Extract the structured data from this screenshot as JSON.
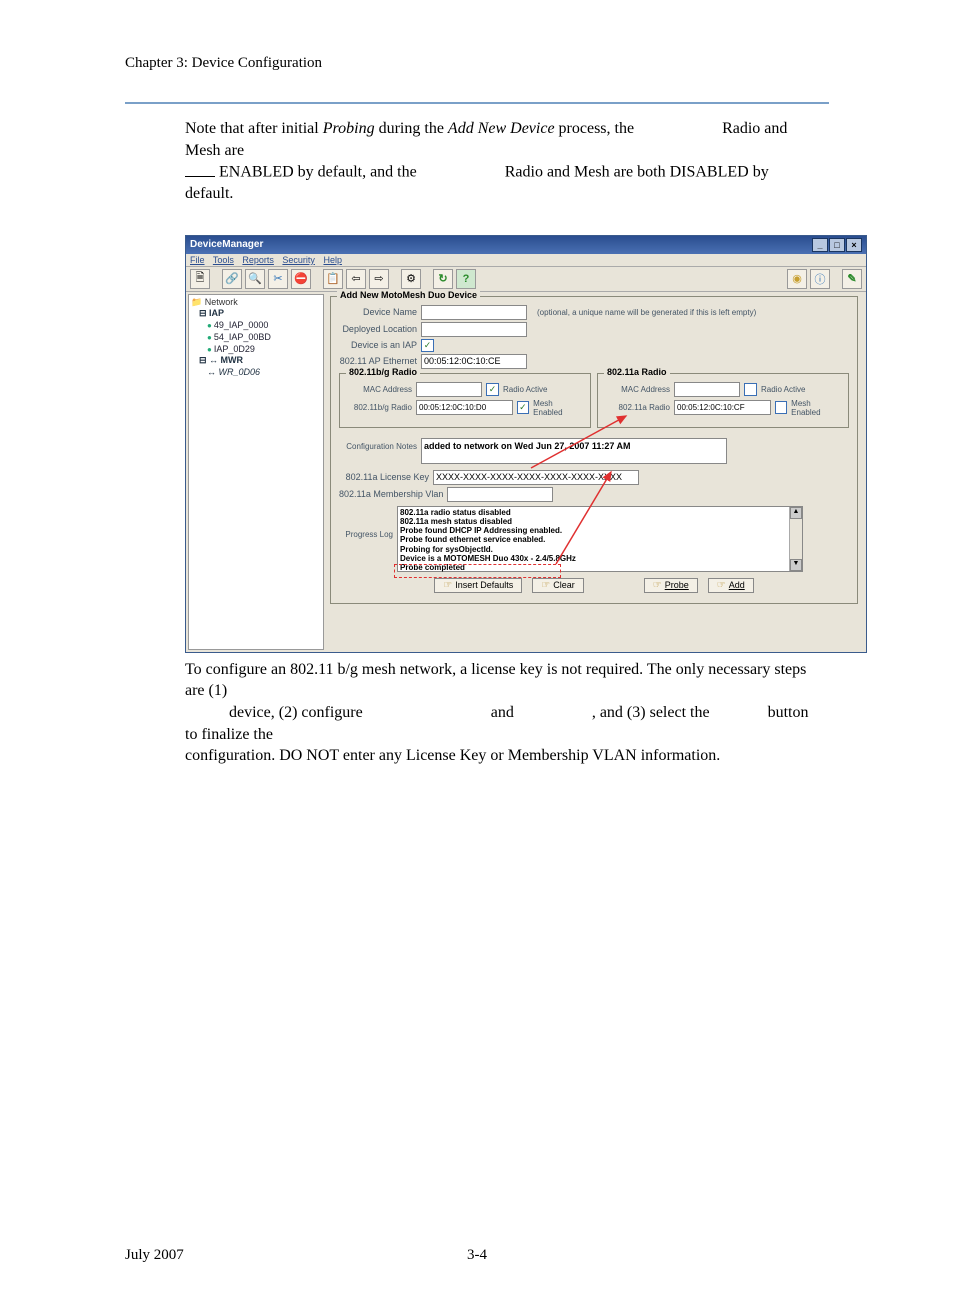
{
  "chapter_header": "Chapter 3: Device Configuration",
  "intro": {
    "l1a": "Note that after initial ",
    "l1b": "Probing",
    "l1c": " during the ",
    "l1d": "Add New Device",
    "l1e": " process, the",
    "l1f": "Radio and Mesh are",
    "l2a": " ENABLED by default, and the",
    "l2b": "Radio and Mesh are both DISABLED by default."
  },
  "window": {
    "title": "DeviceManager",
    "winbtn_min": "_",
    "winbtn_max": "□",
    "winbtn_close": "×"
  },
  "menu": {
    "file": "File",
    "tools": "Tools",
    "reports": "Reports",
    "security": "Security",
    "help": "Help"
  },
  "toolbar_icons": {
    "new": "🗎",
    "link": "🔗",
    "find": "🔍",
    "tools": "✂",
    "stop": "⛔",
    "paste": "📋",
    "back": "⇦",
    "fwd": "⇨",
    "cfg": "⚙",
    "refresh": "↻",
    "help": "?",
    "rec": "◉",
    "info": "ⓘ",
    "pen": "✎"
  },
  "tree": {
    "root": "Network",
    "iap": "IAP",
    "n1": "49_IAP_0000",
    "n2": "54_IAP_00BD",
    "n3": "IAP_0D29",
    "mwr": "MWR",
    "n4": "WR_0D06"
  },
  "mainform": {
    "legend": "Add New MotoMesh Duo Device",
    "device_name_lbl": "Device Name",
    "device_name_hint": "(optional, a unique name will be generated if this is left empty)",
    "deployed_lbl": "Deployed Location",
    "is_iap_lbl": "Device is an IAP",
    "eth_lbl": "802.11 AP Ethernet",
    "eth_val": "00:05:12:0C:10:CE",
    "radio_bg_legend": "802.11b/g Radio",
    "radio_a_legend": "802.11a Radio",
    "mac_lbl": "MAC Address",
    "radio_active_lbl": "Radio Active",
    "mesh_enabled_lbl": "Mesh Enabled",
    "bg_radio_lbl": "802.11b/g Radio",
    "bg_radio_val": "00:05:12:0C:10:D0",
    "a_radio_lbl": "802.11a Radio",
    "a_radio_val": "00:05:12:0C:10:CF",
    "notes_lbl": "Configuration Notes",
    "notes_val": "added to network on Wed Jun 27, 2007 11:27 AM",
    "license_lbl": "802.11a License Key",
    "license_val": "XXXX-XXXX-XXXX-XXXX-XXXX-XXXX-XXXX",
    "vlan_lbl": "802.11a Membership Vlan",
    "progress_lbl": "Progress Log",
    "log": {
      "l1": "802.11a radio status disabled",
      "l2": "802.11a mesh status disabled",
      "l3": "Probe found DHCP IP Addressing enabled.",
      "l4": "Probe found ethernet service enabled.",
      "l5": "Probing for sysObjectId.",
      "l6": "Device is a MOTOMESH Duo 430x - 2.4/5.8GHz",
      "l7": "Probe completed"
    },
    "btn_defaults": "Insert Defaults",
    "btn_clear": "Clear",
    "btn_probe": "Probe",
    "btn_add": "Add",
    "check": "✓",
    "scroll_up": "▲",
    "scroll_dn": "▼"
  },
  "after": {
    "l1": "To configure an 802.11 b/g mesh network, a license key is not required.  The only necessary steps are (1)",
    "l2a": "device, (2) configure",
    "l2b": "and",
    "l2c": ", and (3) select the",
    "l2d": "button to finalize the",
    "l3": "configuration. DO NOT enter any License Key or Membership VLAN information."
  },
  "footer": {
    "date": "July 2007",
    "page": "3-4"
  }
}
